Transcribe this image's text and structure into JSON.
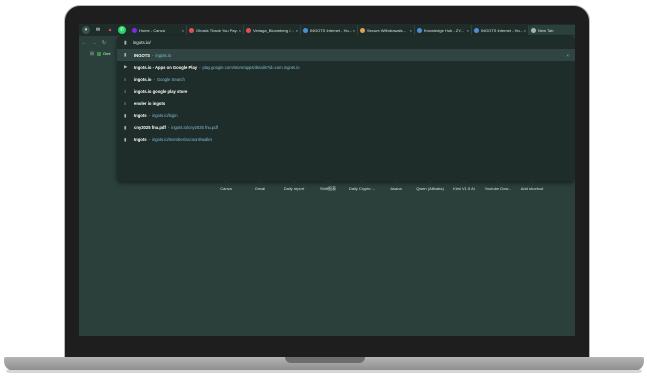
{
  "tabs": [
    {
      "title": "Home - Canva",
      "color": "#7d2ae8"
    },
    {
      "title": "Ghosts Thank You Pay...",
      "color": "#e05252"
    },
    {
      "title": "Verlaga_Bloomberg /...",
      "color": "#e05252"
    },
    {
      "title": "INGOTS Internet - Hu...",
      "color": "#4a90d9"
    },
    {
      "title": "Secure Withdrawals...",
      "color": "#e0a052"
    },
    {
      "title": "Knowledge Hub - ZY...",
      "color": "#4a90d9"
    },
    {
      "title": "INGOTS Internet - Hu...",
      "color": "#4a90d9"
    },
    {
      "title": "New Tab",
      "color": "#9fb7b1"
    }
  ],
  "bookmark": {
    "label": "Gmi"
  },
  "omnibox": {
    "value": "ingots.io/"
  },
  "suggestions": [
    {
      "icon": "ingots-icon",
      "glyph": "▮",
      "main": "INGOTS",
      "sep": "-",
      "url": "ingots.io",
      "selected": true
    },
    {
      "icon": "play-icon",
      "glyph": "▶",
      "main": "Ingots.io - Apps on Google Play",
      "sep": "-",
      "url": "play.google.com/store/apps/details?id=com.ingots.io"
    },
    {
      "icon": "search-icon",
      "glyph": "⌕",
      "main": "ingots.io",
      "sep": "-",
      "url": "Google Search"
    },
    {
      "icon": "search-icon",
      "glyph": "⌕",
      "main": "ingots.io google play store",
      "sep": "",
      "url": ""
    },
    {
      "icon": "search-icon",
      "glyph": "⌕",
      "main": "enoler io ingots",
      "sep": "",
      "url": ""
    },
    {
      "icon": "ingots-icon",
      "glyph": "▮",
      "main": "Ingots",
      "sep": "-",
      "url": "ingots.io/login"
    },
    {
      "icon": "ingots-icon",
      "glyph": "▮",
      "main": "cny2025 fnu.pdf",
      "sep": "-",
      "url": "ingots.io/cny2025 fnu.pdf"
    },
    {
      "icon": "ingots-icon",
      "glyph": "▮",
      "main": "Ingots",
      "sep": "-",
      "url": "ingots.io/member/account/wallet"
    }
  ],
  "shortcuts": [
    {
      "label": "Canva",
      "glyph": "C",
      "color": "#3b6fd8"
    },
    {
      "label": "Gmail",
      "glyph": "M",
      "color": "#4a6fa5"
    },
    {
      "label": "Daily report",
      "glyph": "▦",
      "color": "#3c8f4a"
    },
    {
      "label": "Shift报表",
      "glyph": "●",
      "color": "#b03ad6"
    },
    {
      "label": "Daily Crypto ...",
      "glyph": "◐",
      "color": "#d68a3a"
    },
    {
      "label": "Asana",
      "glyph": "⁂",
      "color": "#e0645a"
    },
    {
      "label": "Qwen (Alibaba)",
      "glyph": "✦",
      "color": "#7b5ae0"
    },
    {
      "label": "Kimi V1.5 AI",
      "glyph": "K",
      "color": "#444444"
    },
    {
      "label": "Youtube Dow...",
      "glyph": "▶",
      "color": "#e05252"
    },
    {
      "label": "Add shortcut",
      "glyph": "+",
      "color": "#3c514c"
    }
  ]
}
